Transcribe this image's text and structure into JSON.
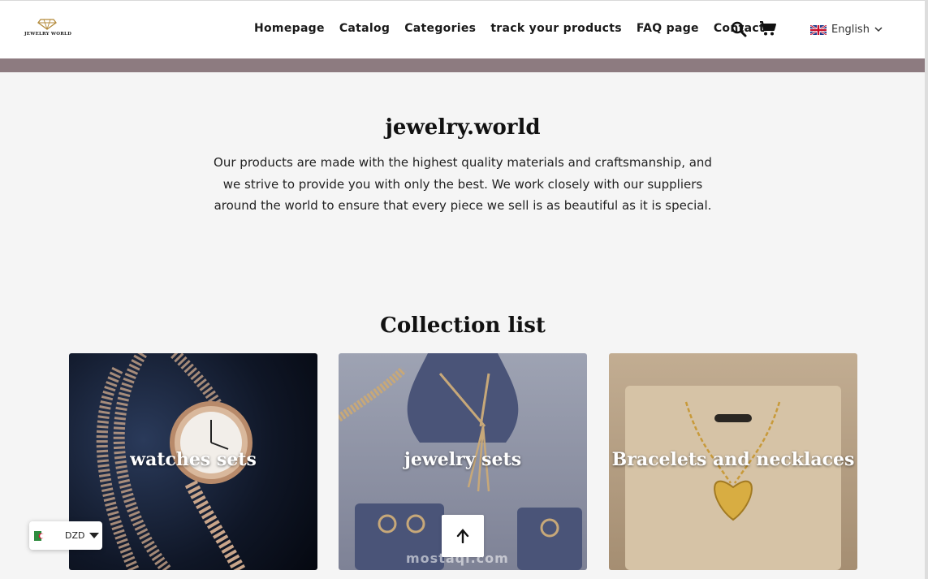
{
  "header": {
    "logo_text": "JEWELRY WORLD",
    "nav": [
      "Homepage",
      "Catalog",
      "Categories",
      "track your products",
      "FAQ page",
      "Contact"
    ],
    "search_icon": "search-icon",
    "cart_icon": "cart-icon",
    "language": "English"
  },
  "intro": {
    "title": "jewelry.world",
    "text": "Our products are made with the highest quality materials and craftsmanship, and we strive to provide you with only the best. We work closely with our suppliers around the world to ensure that every piece we sell is as beautiful as it is special."
  },
  "collection": {
    "title": "Collection list",
    "cards": [
      "watches sets",
      "jewelry sets",
      "Bracelets and necklaces"
    ]
  },
  "currency": {
    "code": "DZD"
  },
  "watermark": "mostaqi.com",
  "colors": {
    "band": "#8d7b80",
    "background": "#f5f5f5"
  }
}
